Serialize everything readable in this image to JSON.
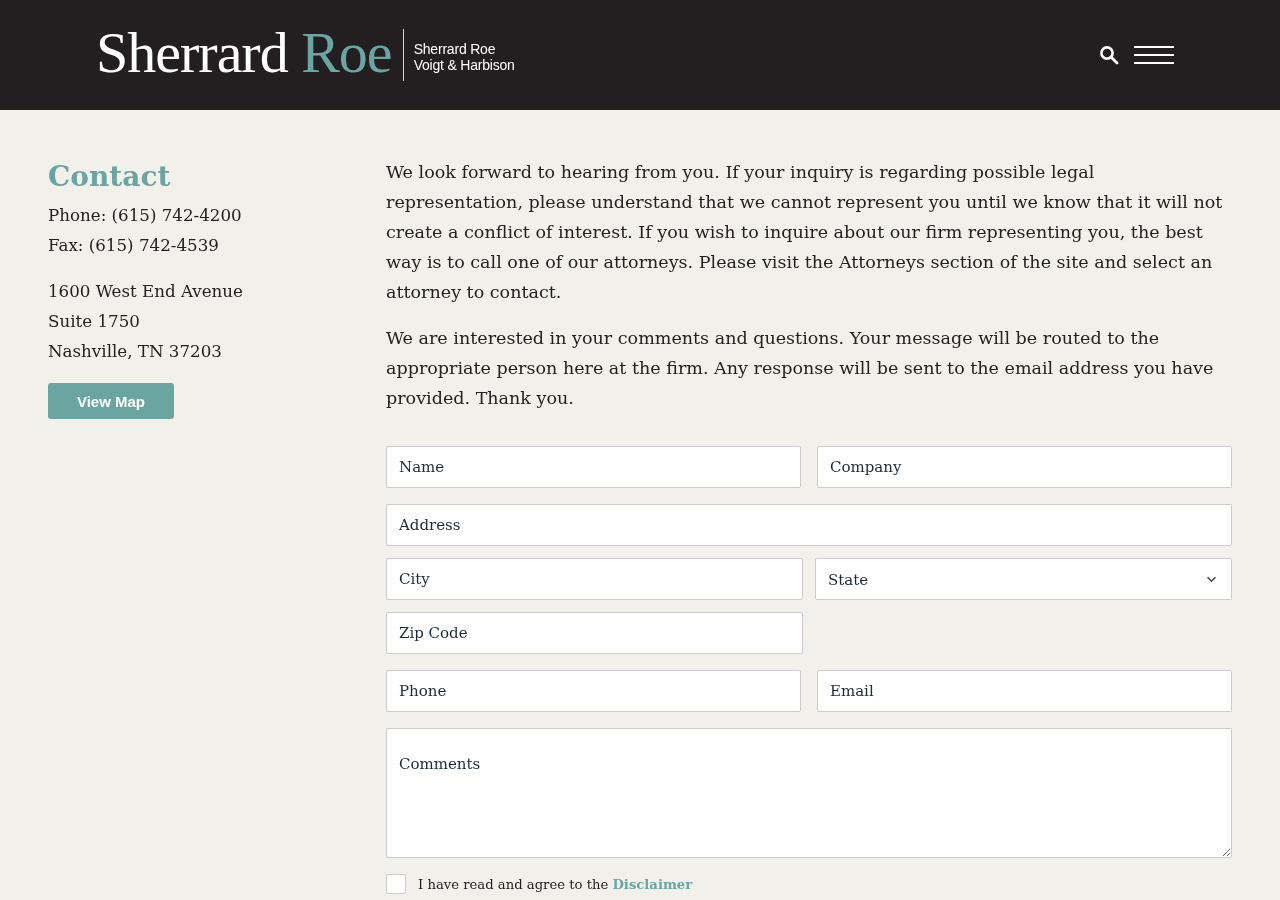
{
  "header": {
    "logo": {
      "wordmark": "Sherrard",
      "wordmark_accent": "Roe",
      "subtitle_lines": [
        "Sherrard Roe",
        "Voigt & Harbison"
      ]
    }
  },
  "contact": {
    "heading": "Contact",
    "phone_lines": [
      "Phone: (615) 742-4200",
      "Fax: (615) 742-4539"
    ],
    "address_lines": [
      "1600 West End Avenue",
      "Suite 1750",
      "Nashville, TN 37203"
    ],
    "map_button": "View Map"
  },
  "intro_paragraphs": [
    "We look forward to hearing from you. If your inquiry is regarding possible legal representation, please understand that we cannot represent you until we know that it will not create a conflict of interest. If you wish to inquire about our firm representing you, the best way is to call one of our attorneys. Please visit the Attorneys section of the site and select an attorney to contact.",
    "We are interested in your comments and questions. Your message will be routed to the appropriate person here at the firm. Any response will be sent to the email address you have provided. Thank you."
  ],
  "form": {
    "field_groups": [
      [
        {
          "kind": "input",
          "placeholder": "Name",
          "wide": false
        },
        {
          "kind": "input",
          "placeholder": "Company",
          "wide": false
        },
        {
          "kind": "input",
          "placeholder": "Address",
          "wide": true
        }
      ],
      [
        {
          "kind": "input",
          "placeholder": "City",
          "wide": false
        },
        {
          "kind": "select",
          "value": "State",
          "wide": false
        },
        {
          "kind": "input",
          "placeholder": "Zip Code",
          "wide": false
        }
      ],
      [
        {
          "kind": "input",
          "placeholder": "Phone",
          "wide": false
        },
        {
          "kind": "input",
          "placeholder": "Email",
          "wide": false
        },
        {
          "kind": "textarea",
          "placeholder": "Comments",
          "wide": true
        }
      ]
    ],
    "agreement": {
      "checked": false,
      "text": "I have read and agree to the",
      "link": "Disclaimer"
    }
  }
}
